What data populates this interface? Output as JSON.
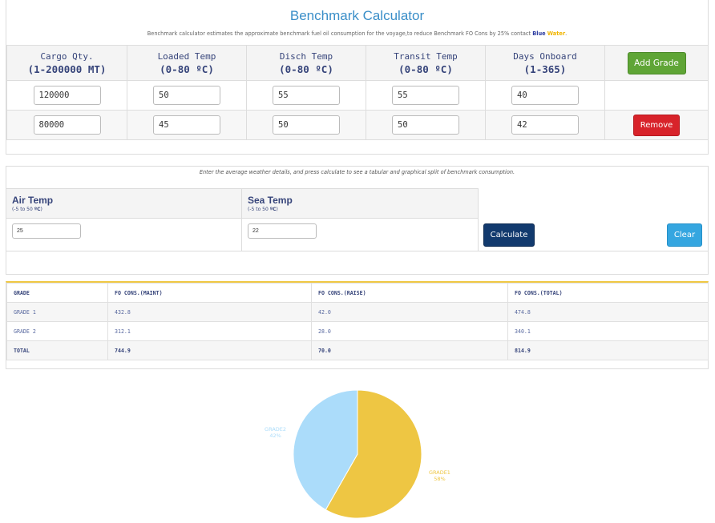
{
  "header": {
    "title": "Benchmark Calculator",
    "subtitle_prefix": "Benchmark calculator estimates the approximate benchmark fuel oil consumption for the voyage,to reduce Benchmark FO Cons by 25% contact ",
    "brand_blue": "Blue",
    "brand_water": "Water",
    "subtitle_suffix": "."
  },
  "grades_table": {
    "columns": [
      {
        "label": "Cargo Qty.",
        "range": "(1-200000 MT)"
      },
      {
        "label": "Loaded Temp",
        "range": "(0-80 ºC)"
      },
      {
        "label": "Disch Temp",
        "range": "(0-80 ºC)"
      },
      {
        "label": "Transit Temp",
        "range": "(0-80 ºC)"
      },
      {
        "label": "Days Onboard",
        "range": "(1-365)"
      }
    ],
    "add_button": "Add Grade",
    "remove_button": "Remove",
    "rows": [
      {
        "values": [
          "120000",
          "50",
          "55",
          "55",
          "40"
        ]
      },
      {
        "values": [
          "80000",
          "45",
          "50",
          "50",
          "42"
        ]
      }
    ]
  },
  "weather": {
    "note": "Enter the average weather details, and press calculate to see a tabular and graphical split of benchmark consumption.",
    "air_label": "Air Temp",
    "air_range_prefix": "(-5 to 50 ",
    "air_range_unit": "ºC",
    "air_range_suffix": ")",
    "sea_label": "Sea Temp",
    "sea_range_prefix": "(-5 to 50 ",
    "sea_range_unit": "ºC",
    "sea_range_suffix": ")",
    "air_value": "25",
    "sea_value": "22",
    "calculate_button": "Calculate",
    "clear_button": "Clear"
  },
  "results": {
    "headers": [
      "GRADE",
      "FO CONS.(MAINT)",
      "FO CONS.(RAISE)",
      "FO CONS.(TOTAL)"
    ],
    "rows": [
      [
        "GRADE 1",
        "432.8",
        "42.0",
        "474.8"
      ],
      [
        "GRADE 2",
        "312.1",
        "28.0",
        "340.1"
      ]
    ],
    "total": [
      "TOTAL",
      "744.9",
      "70.0",
      "814.9"
    ]
  },
  "pie": {
    "slices": [
      {
        "label": "GRADE1",
        "percent_label": "58%",
        "value": 474.8,
        "color": "#eec643"
      },
      {
        "label": "GRADE2",
        "percent_label": "42%",
        "value": 340.1,
        "color": "#abdcfa"
      }
    ]
  },
  "colors": {
    "title_blue": "#3a8ec8",
    "add_green": "#5fa536",
    "remove_red": "#d8232a",
    "calculate_navy": "#123a6e",
    "clear_sky": "#35a6e0",
    "header_navy": "#36447a"
  }
}
